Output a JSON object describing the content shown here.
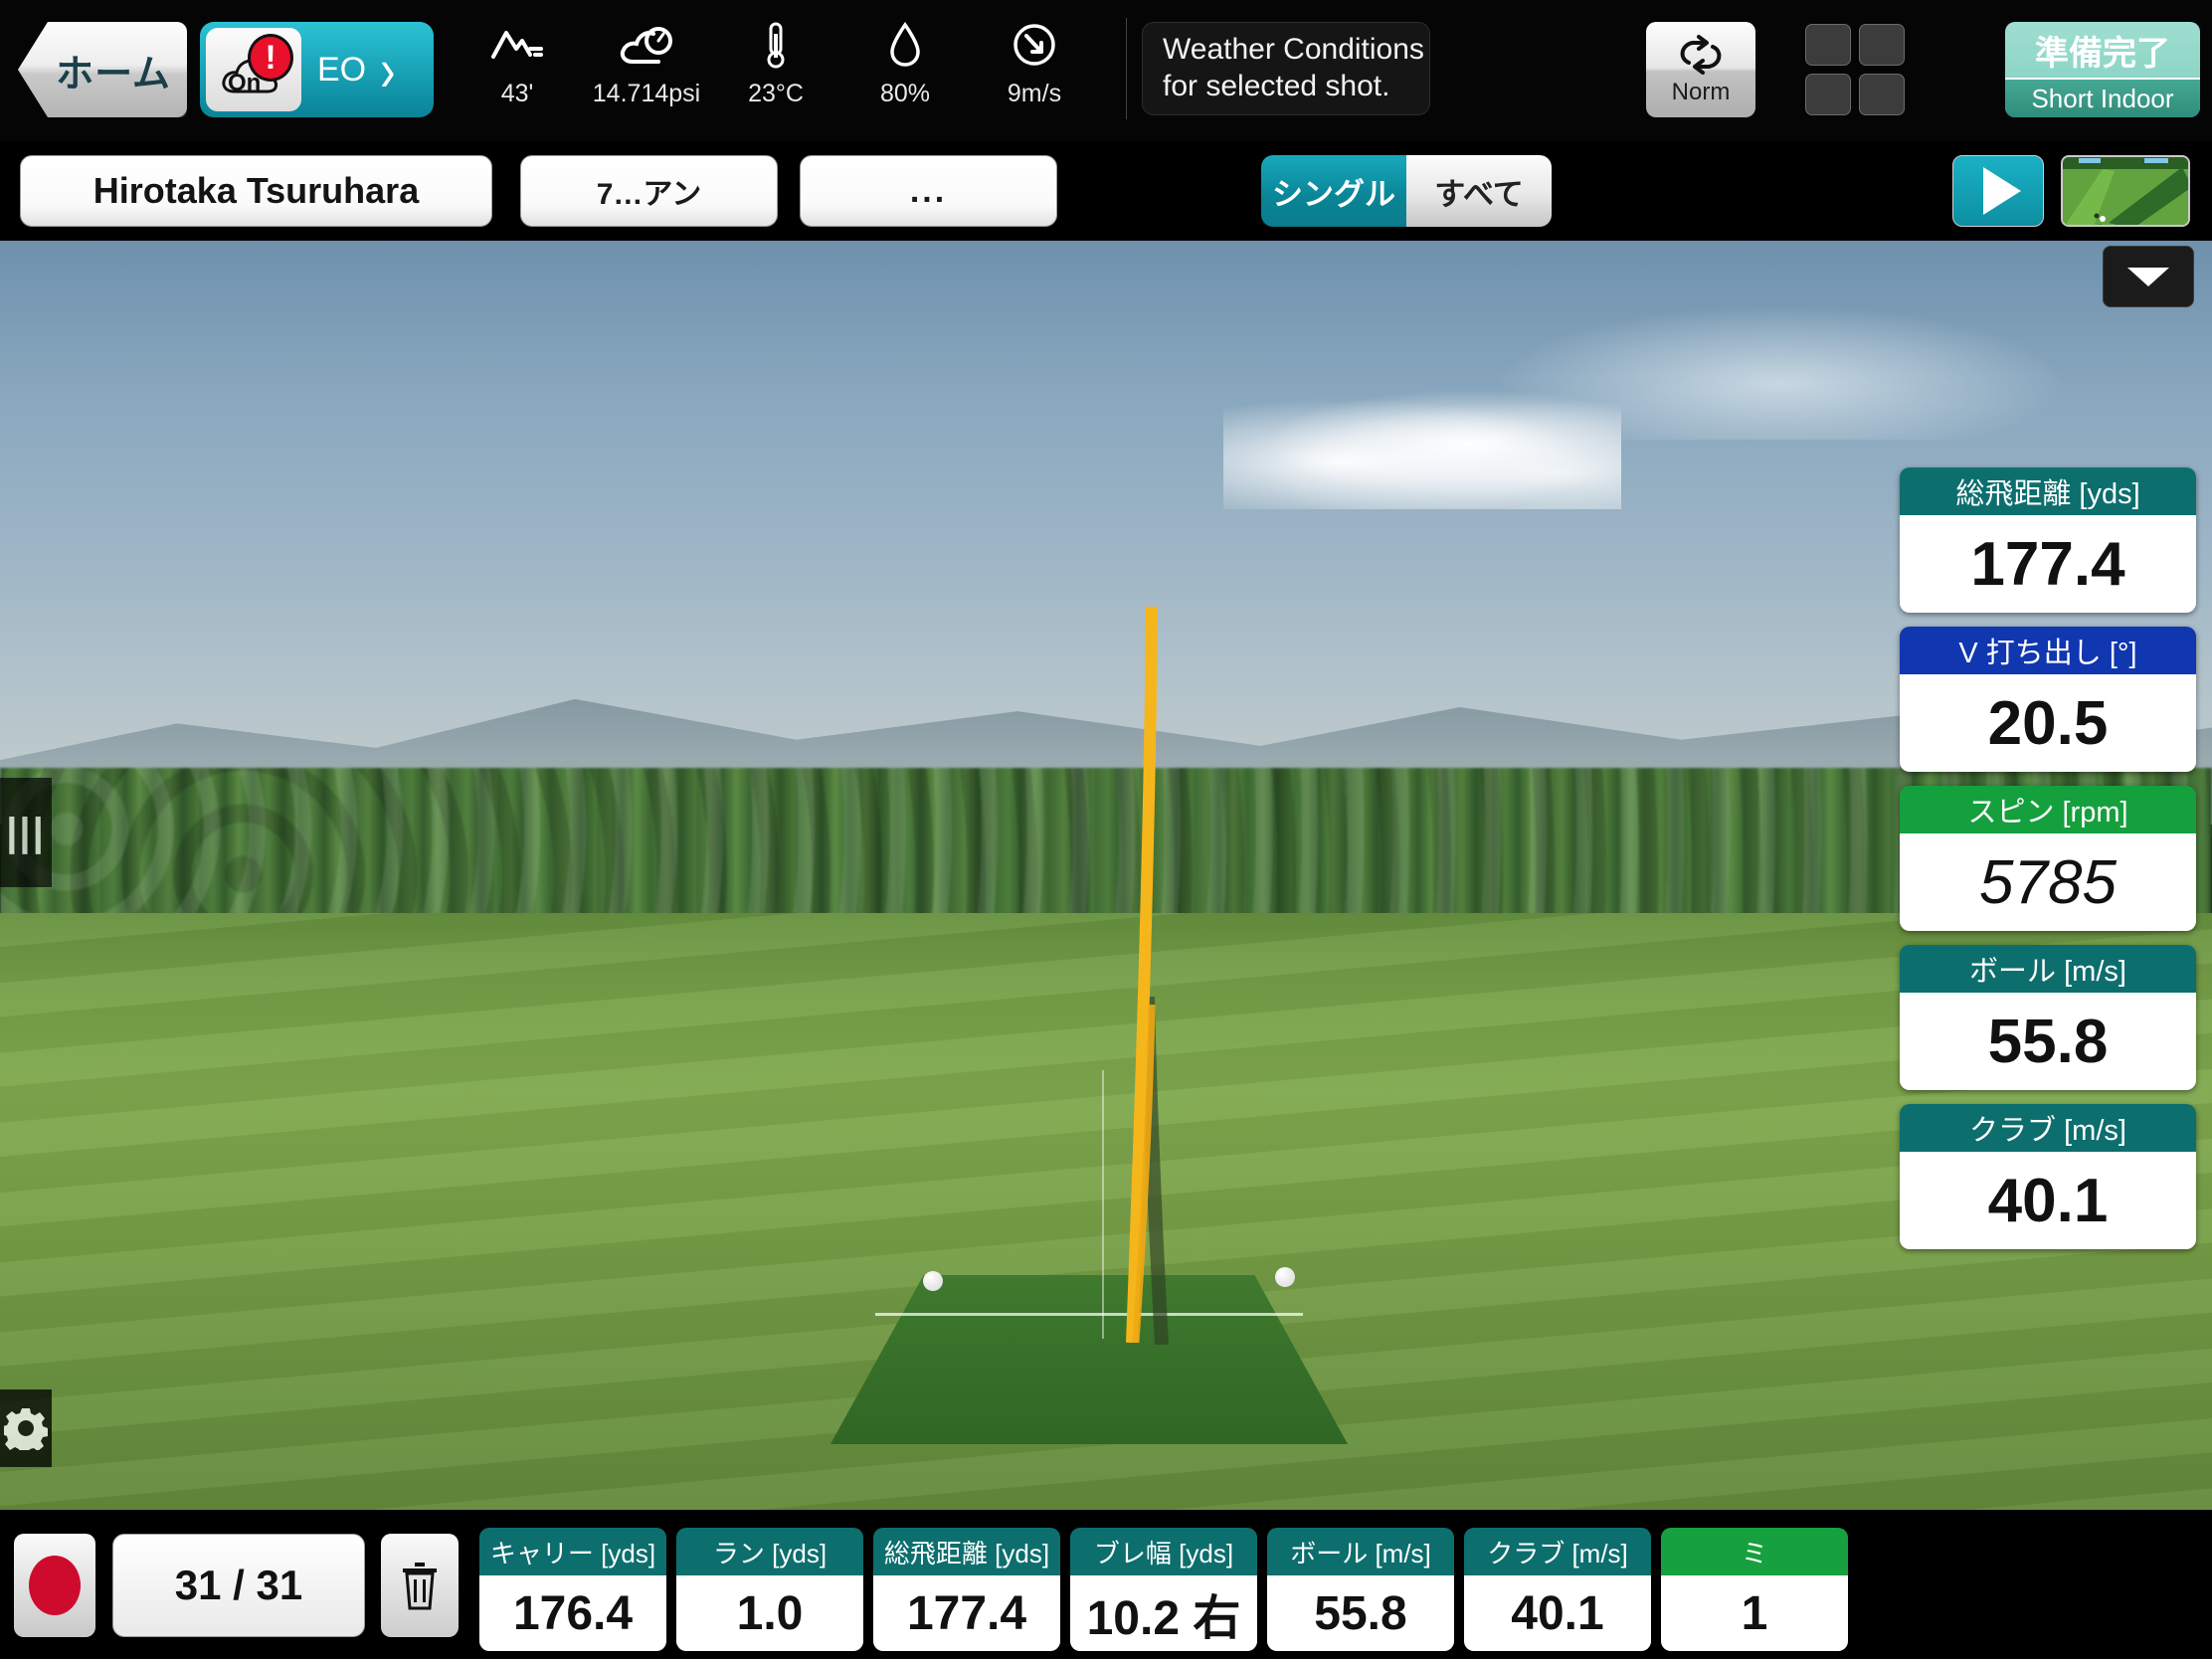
{
  "topbar": {
    "home_label": "ホーム",
    "eo": {
      "status": "On",
      "label": "EO",
      "alert": "!",
      "chevron": "chevron-right"
    },
    "weather": [
      {
        "icon": "mountain-altitude-icon",
        "value": "43'"
      },
      {
        "icon": "cloud-pressure-icon",
        "value": "14.714psi"
      },
      {
        "icon": "thermometer-icon",
        "value": "23°C"
      },
      {
        "icon": "humidity-drop-icon",
        "value": "80%"
      },
      {
        "icon": "wind-direction-icon",
        "value": "9m/s"
      }
    ],
    "note_line1": "Weather Conditions",
    "note_line2": "for selected shot.",
    "norm_label": "Norm",
    "ready_title": "準備完了",
    "ready_sub": "Short Indoor"
  },
  "subbar": {
    "player_name": "Hirotaka Tsuruhara",
    "club": "7…アン",
    "more": "...",
    "tabs": [
      {
        "label": "シングル",
        "active": true
      },
      {
        "label": "すべて",
        "active": false
      }
    ],
    "play_icon": "play-icon",
    "minimap": "course-minimap"
  },
  "view": {
    "side_tab": "|||",
    "gear_icon": "gear-icon",
    "help_icon": "question-mark-icon",
    "collapse_icon": "chevron-down-icon"
  },
  "cards": [
    {
      "label": "総飛距離 [yds]",
      "value": "177.4",
      "color": "#0d6e6e",
      "italic": false
    },
    {
      "label": "V 打ち出し [°]",
      "value": "20.5",
      "color": "#1036b0",
      "italic": false
    },
    {
      "label": "スピン [rpm]",
      "value": "5785",
      "color": "#15a03e",
      "italic": true
    },
    {
      "label": "ボール [m/s]",
      "value": "55.8",
      "color": "#0d6e6e",
      "italic": false
    },
    {
      "label": "クラブ [m/s]",
      "value": "40.1",
      "color": "#0d6e6e",
      "italic": false
    }
  ],
  "bottom": {
    "record_icon": "record-icon",
    "shot_count": "31 / 31",
    "trash_icon": "trash-icon",
    "stats": [
      {
        "label": "キャリー [yds]",
        "value": "176.4",
        "accent": "#0d6e6e"
      },
      {
        "label": "ラン [yds]",
        "value": "1.0",
        "accent": "#0d6e6e"
      },
      {
        "label": "総飛距離 [yds]",
        "value": "177.4",
        "accent": "#0d6e6e"
      },
      {
        "label": "ブレ幅 [yds]",
        "value": "10.2 右",
        "accent": "#0d6e6e"
      },
      {
        "label": "ボール [m/s]",
        "value": "55.8",
        "accent": "#0d6e6e"
      },
      {
        "label": "クラブ [m/s]",
        "value": "40.1",
        "accent": "#0d6e6e"
      },
      {
        "label": "ミ",
        "value": "1",
        "accent": "#16a03f"
      }
    ]
  },
  "colors": {
    "accent_teal": "#0d8fa3",
    "header_teal": "#0d6e6e",
    "blue": "#1036b0",
    "green": "#15a03e",
    "record_red": "#cf0b2d"
  }
}
